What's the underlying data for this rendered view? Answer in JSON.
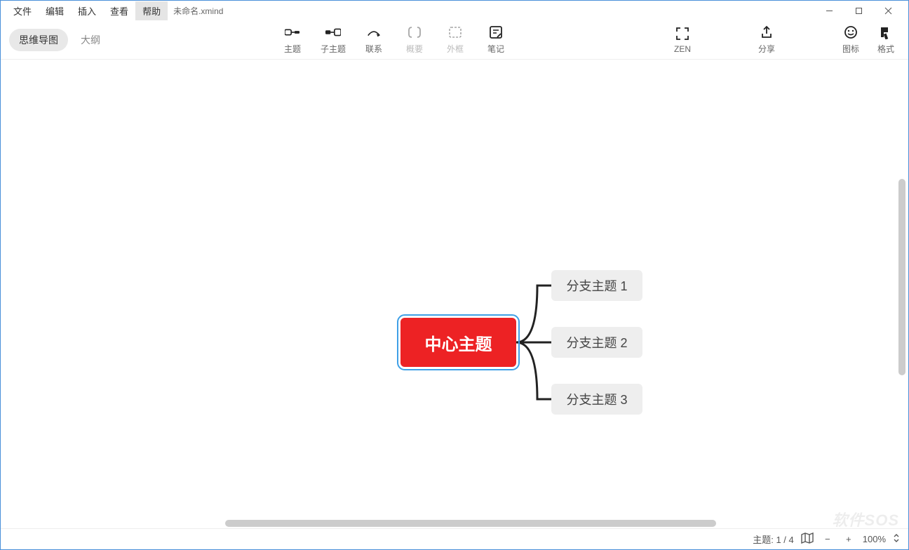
{
  "menu": {
    "file": "文件",
    "edit": "编辑",
    "insert": "插入",
    "view": "查看",
    "help": "帮助",
    "filename": "未命名.xmind"
  },
  "viewtabs": {
    "mindmap": "思维导图",
    "outline": "大纲"
  },
  "toolbar": {
    "topic": "主题",
    "subtopic": "子主题",
    "relation": "联系",
    "summary": "概要",
    "boundary": "外框",
    "note": "笔记",
    "zen": "ZEN",
    "share": "分享",
    "icons": "图标",
    "format": "格式"
  },
  "mindmap": {
    "central": "中心主题",
    "branches": [
      "分支主题 1",
      "分支主题 2",
      "分支主题 3"
    ]
  },
  "status": {
    "topic_label": "主题:",
    "topic_count": "1 / 4",
    "zoom": "100%"
  },
  "watermark": "软件SOS"
}
